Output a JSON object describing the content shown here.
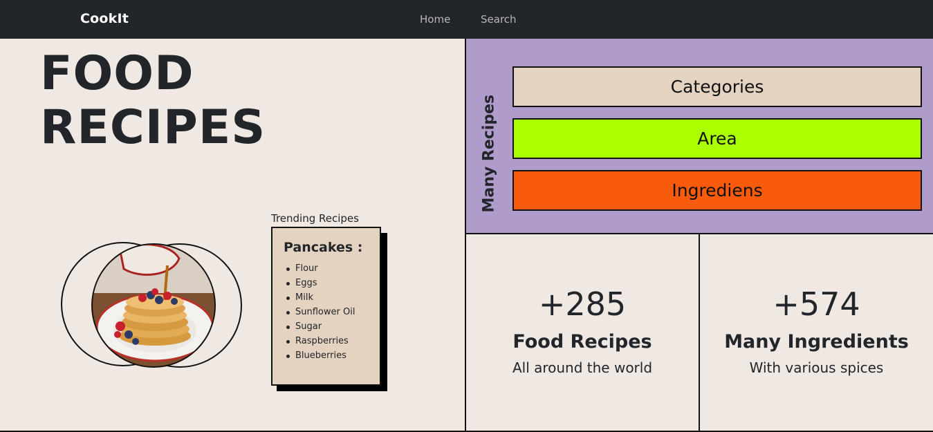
{
  "navbar": {
    "brand": "CookIt",
    "links": [
      "Home",
      "Search"
    ]
  },
  "hero": {
    "title_line1": "FOOD",
    "title_line2": "RECIPES"
  },
  "trending": {
    "label": "Trending Recipes",
    "recipe_name": "Pancakes :",
    "ingredients": [
      "Flour",
      "Eggs",
      "Milk",
      "Sunflower Oil",
      "Sugar",
      "Raspberries",
      "Blueberries"
    ]
  },
  "menu": {
    "vertical_label": "Many Recipes",
    "buttons": [
      {
        "label": "Categories",
        "color": "#e3d3c0"
      },
      {
        "label": "Area",
        "color": "#aaff00"
      },
      {
        "label": "Ingrediens",
        "color": "#f95b0c"
      }
    ]
  },
  "stats": [
    {
      "number": "+285",
      "title": "Food Recipes",
      "subtitle": "All around the world"
    },
    {
      "number": "+574",
      "title": "Many Ingredients",
      "subtitle": "With various spices"
    }
  ],
  "colors": {
    "navbar_bg": "#222529",
    "page_bg": "#f0e9e3",
    "panel_purple": "#b09ccb",
    "card_beige": "#e3d3c0"
  }
}
